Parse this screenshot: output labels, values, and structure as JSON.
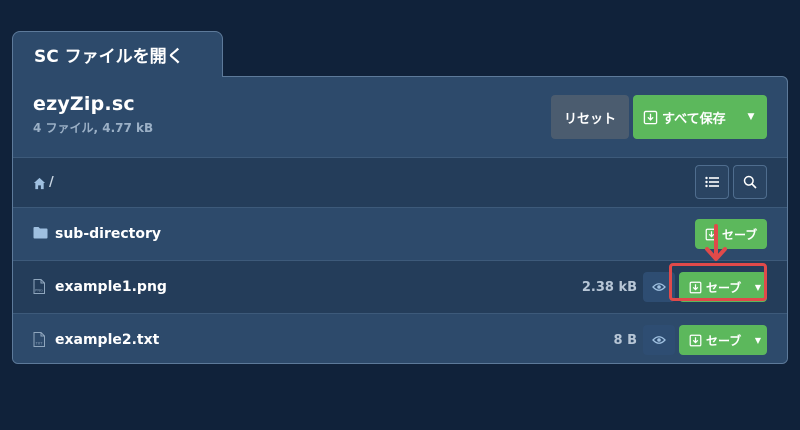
{
  "tab": {
    "label": "SC ファイルを開く"
  },
  "archive": {
    "name": "ezyZip.sc",
    "summary": "4 ファイル, 4.77 kB"
  },
  "buttons": {
    "reset": "リセット",
    "save_all": "すべて保存",
    "save": "セーブ"
  },
  "path": {
    "current": "/"
  },
  "rows": [
    {
      "type": "folder",
      "name": "sub-directory",
      "size": ""
    },
    {
      "type": "file",
      "ext": "PNG",
      "name": "example1.png",
      "size": "2.38 kB"
    },
    {
      "type": "file",
      "ext": "TXT",
      "name": "example2.txt",
      "size": "8 B"
    }
  ],
  "colors": {
    "background": "#10223a",
    "panel": "#2d4a6b",
    "green": "#5cb85c",
    "reset": "#4b5c6f",
    "highlight": "#e04a4a"
  },
  "icons": [
    "home-icon",
    "list-icon",
    "search-icon",
    "folder-icon",
    "file-icon",
    "eye-icon",
    "download-icon",
    "caret-down-icon",
    "arrow-down-icon"
  ]
}
